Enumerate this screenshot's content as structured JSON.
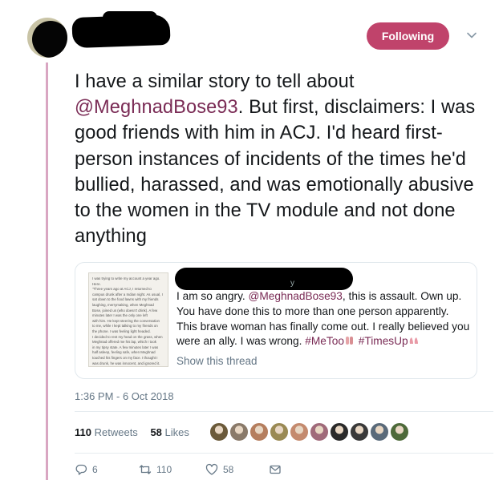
{
  "header": {
    "follow_label": "Following"
  },
  "tweet": {
    "text_before_mention": "I have a similar story to tell about ",
    "mention": "@MeghnadBose93",
    "text_after_mention": ". But first, disclaimers: I was good friends with him in ACJ. I'd heard first-person instances of incidents of the times he'd bullied, harassed, and was emotionally abusive to the women in the TV module and not done anything",
    "timestamp": "1:36 PM - 6 Oct 2018"
  },
  "quoted_tweet": {
    "handle_fragment": "y",
    "text_start": "I am so angry. ",
    "mention": "@MeghnadBose93",
    "text_middle": ", this is assault. Own up. You have done this to more than one person apparently. This brave woman has finally come out. I really believed you were an ally. I was wrong. ",
    "hashtag1": "#MeToo",
    "hashtag2": "#TimesUp",
    "show_thread": "Show this thread",
    "image_lines": [
      "I was trying to write my account a year ago.",
      "Here.",
      "\"Three years ago at ACJ, I returned to",
      "campus drunk after a Indian night. As usual, I",
      "sat down to the food lawns with my friends",
      "laughing, merrymaking, when Meghnad",
      "Bose, joined us (who doesn't drink). A few",
      "minutes later I was the only one left",
      "with him. He kept steering the conversation",
      "to me, while I kept talking to my friends on",
      "the phone. I was feeling light headed.",
      "I decided to rest my head on the grass, when",
      "Meghnad offered me his lap, which I took",
      "in my tipsy state. A few minutes later I was",
      "half asleep, feeling safe, when Meghnad",
      "touched his fingers on my face. I thought I",
      "was drunk, he was innocent, and ignored it.",
      "But he did it again. He touched my lips, my",
      "mouth, and forced his finger inside my",
      "mouth. I knew then that it wasn't a mistake.",
      "What I did after it is what most of us",
      "women do. I got up and left.\""
    ]
  },
  "stats": {
    "retweets_count": "110",
    "retweets_label": "Retweets",
    "likes_count": "58",
    "likes_label": "Likes"
  },
  "likers": [
    {
      "color": "#6b5a3a",
      "icon": "avatar"
    },
    {
      "color": "#8a7a6a",
      "icon": "avatar"
    },
    {
      "color": "#b57e5e",
      "icon": "avatar"
    },
    {
      "color": "#9a8a54",
      "icon": "avatar"
    },
    {
      "color": "#c48a6e",
      "icon": "avatar"
    },
    {
      "color": "#a06a7a",
      "icon": "avatar"
    },
    {
      "color": "#2a2a2a",
      "icon": "avatar"
    },
    {
      "color": "#3a3a3a",
      "icon": "avatar"
    },
    {
      "color": "#5a6a7a",
      "icon": "avatar"
    },
    {
      "color": "#4e6a3a",
      "icon": "avatar"
    }
  ],
  "actions": {
    "reply_count": "6",
    "retweet_count": "110",
    "like_count": "58"
  },
  "colors": {
    "accent": "#c0436b",
    "mention": "#7a2b55",
    "secondary_text": "#657786",
    "thread_line": "#d9a6c2"
  }
}
